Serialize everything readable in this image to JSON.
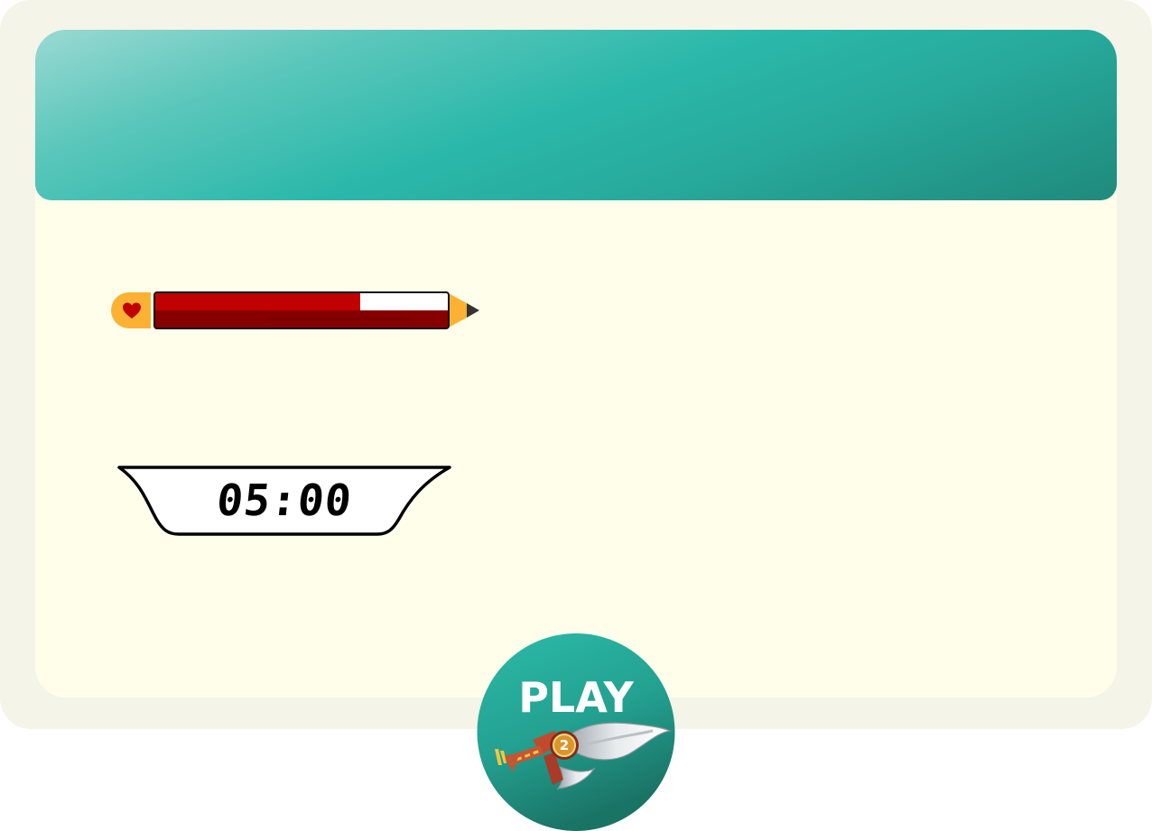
{
  "timer": {
    "display": "05:00"
  },
  "health": {
    "level": 0.7,
    "icon": "heart-icon"
  },
  "play_button": {
    "label": "PLAY",
    "badge_number": "2",
    "icon": "sword-icon"
  },
  "colors": {
    "header_gradient_start": "#9ad9d3",
    "header_gradient_mid": "#2ab8aa",
    "header_gradient_end": "#1f8a7c",
    "health_fill": "#c10000",
    "health_dark": "#870000",
    "accent_orange": "#fbb233",
    "panel_background": "#fefeeb",
    "frame_background": "#f4f4e8"
  }
}
